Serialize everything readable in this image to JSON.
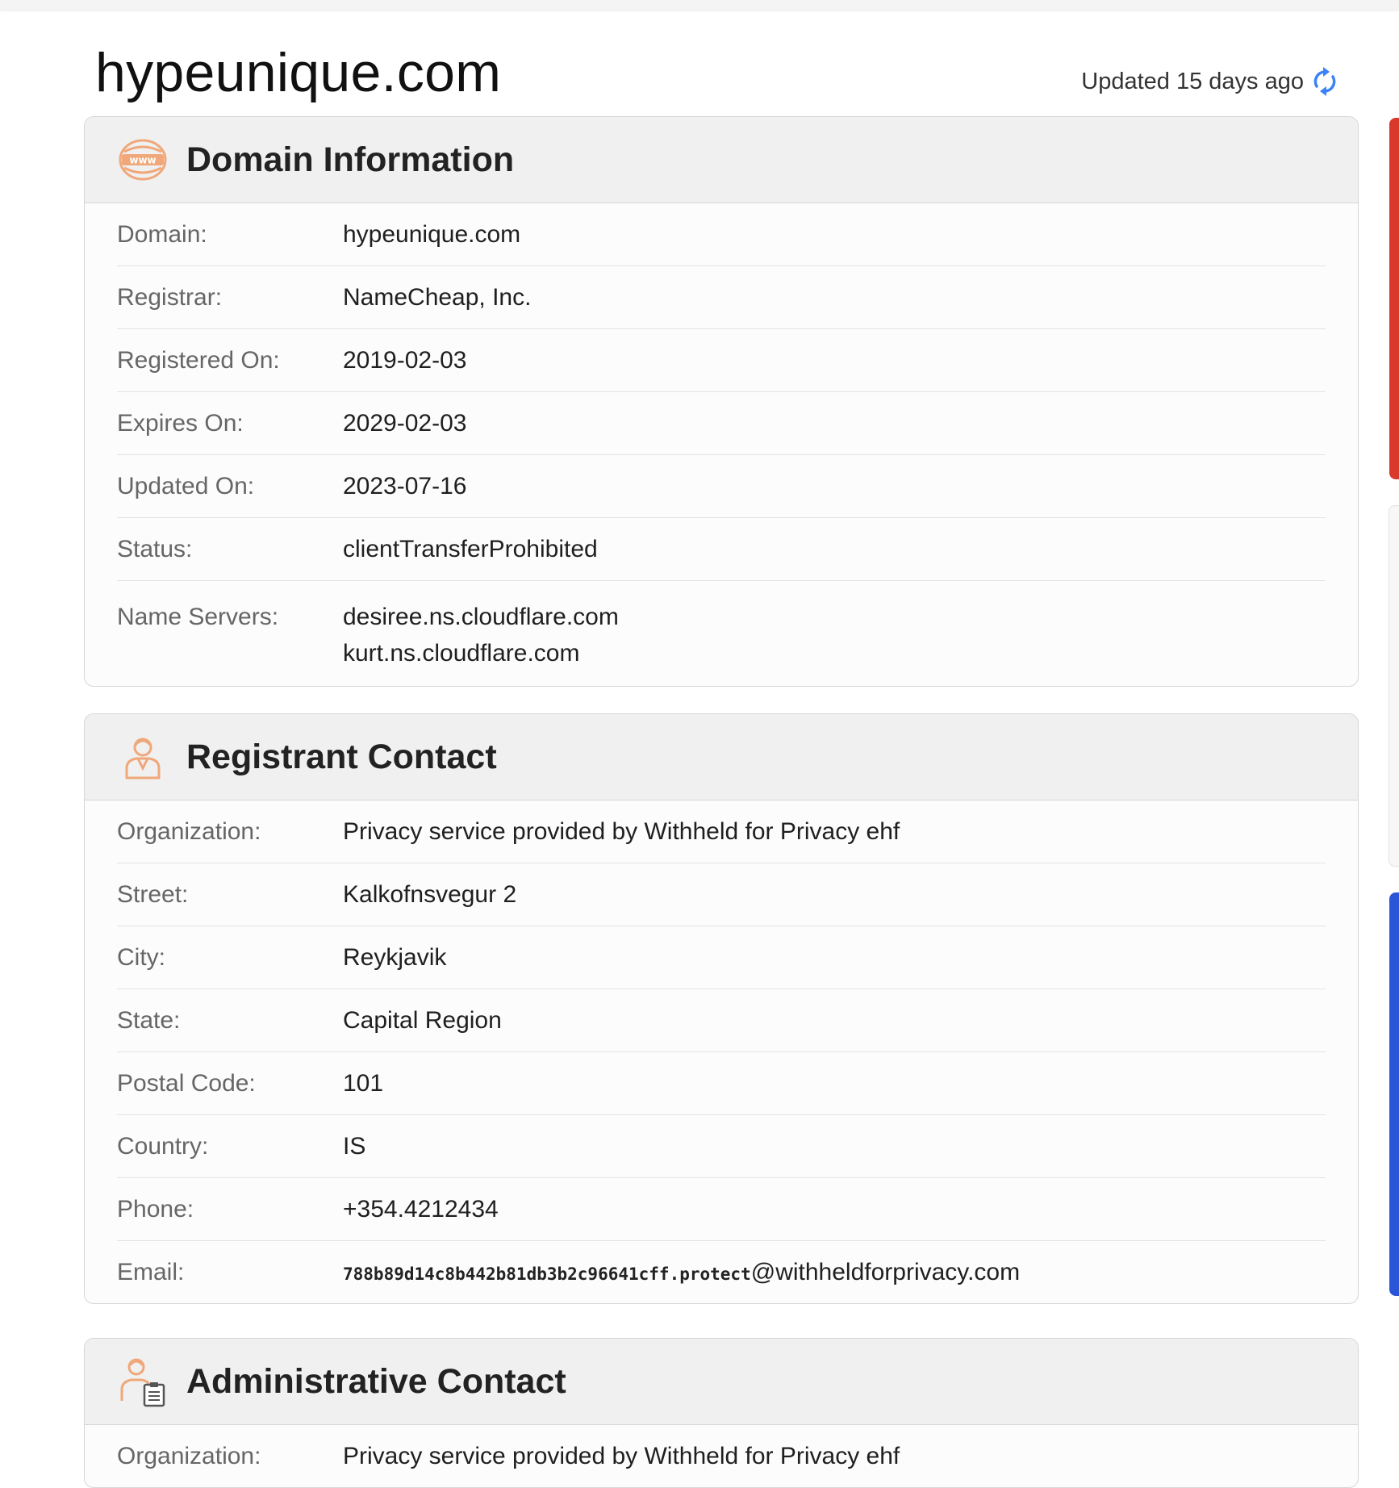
{
  "page": {
    "title": "hypeunique.com",
    "updated_text": "Updated 15 days ago"
  },
  "colors": {
    "accent_orange": "#f0a77a",
    "refresh_blue": "#3b82f6",
    "side_red": "#d8392b",
    "side_blue": "#2b55d8"
  },
  "domain_info": {
    "icon": "www-globe-icon",
    "title": "Domain Information",
    "rows": [
      {
        "label": "Domain:",
        "value": "hypeunique.com"
      },
      {
        "label": "Registrar:",
        "value": "NameCheap, Inc."
      },
      {
        "label": "Registered On:",
        "value": "2019-02-03"
      },
      {
        "label": "Expires On:",
        "value": "2029-02-03"
      },
      {
        "label": "Updated On:",
        "value": "2023-07-16"
      },
      {
        "label": "Status:",
        "value": "clientTransferProhibited"
      }
    ],
    "name_servers": {
      "label": "Name Servers:",
      "values": [
        "desiree.ns.cloudflare.com",
        "kurt.ns.cloudflare.com"
      ]
    }
  },
  "registrant": {
    "icon": "person-icon",
    "title": "Registrant Contact",
    "rows": [
      {
        "label": "Organization:",
        "value": "Privacy service provided by Withheld for Privacy ehf"
      },
      {
        "label": "Street:",
        "value": "Kalkofnsvegur 2"
      },
      {
        "label": "City:",
        "value": "Reykjavik"
      },
      {
        "label": "State:",
        "value": "Capital Region"
      },
      {
        "label": "Postal Code:",
        "value": "101"
      },
      {
        "label": "Country:",
        "value": "IS"
      },
      {
        "label": "Phone:",
        "value": "+354.4212434"
      }
    ],
    "email": {
      "label": "Email:",
      "local_part": "788b89d14c8b442b81db3b2c96641cff.protect",
      "domain_part": "@withheldforprivacy.com"
    }
  },
  "admin": {
    "icon": "person-clipboard-icon",
    "title": "Administrative Contact",
    "rows": [
      {
        "label": "Organization:",
        "value": "Privacy service provided by Withheld for Privacy ehf"
      }
    ]
  }
}
